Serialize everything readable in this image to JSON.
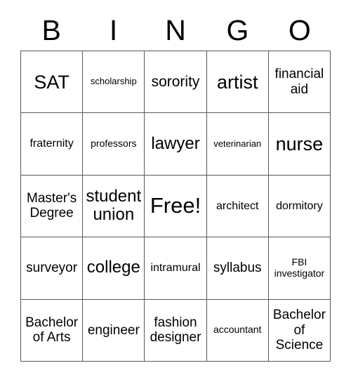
{
  "card": {
    "header_letters": [
      "B",
      "I",
      "N",
      "G",
      "O"
    ],
    "grid_line_color": "#595959",
    "background_color": "#ffffff",
    "text_color": "#000000",
    "rows": [
      [
        {
          "label": "SAT",
          "size": "xxl"
        },
        {
          "label": "scholarship",
          "size": "xxs"
        },
        {
          "label": "sorority",
          "size": "l"
        },
        {
          "label": "artist",
          "size": "xxl"
        },
        {
          "label": "financial aid",
          "size": "m"
        }
      ],
      [
        {
          "label": "fraternity",
          "size": "s"
        },
        {
          "label": "professors",
          "size": "xs"
        },
        {
          "label": "lawyer",
          "size": "xl"
        },
        {
          "label": "veterinarian",
          "size": "xxs"
        },
        {
          "label": "nurse",
          "size": "xxl"
        }
      ],
      [
        {
          "label": "Master's Degree",
          "size": "m"
        },
        {
          "label": "student union",
          "size": "xl"
        },
        {
          "label": "Free!",
          "size": "free"
        },
        {
          "label": "architect",
          "size": "s"
        },
        {
          "label": "dormitory",
          "size": "s"
        }
      ],
      [
        {
          "label": "surveyor",
          "size": "m"
        },
        {
          "label": "college",
          "size": "xl"
        },
        {
          "label": "intramural",
          "size": "s"
        },
        {
          "label": "syllabus",
          "size": "m"
        },
        {
          "label": "FBI investigator",
          "size": "xs"
        }
      ],
      [
        {
          "label": "Bachelor of Arts",
          "size": "m"
        },
        {
          "label": "engineer",
          "size": "m"
        },
        {
          "label": "fashion designer",
          "size": "m"
        },
        {
          "label": "accountant",
          "size": "xs"
        },
        {
          "label": "Bachelor of Science",
          "size": "m"
        }
      ]
    ]
  }
}
